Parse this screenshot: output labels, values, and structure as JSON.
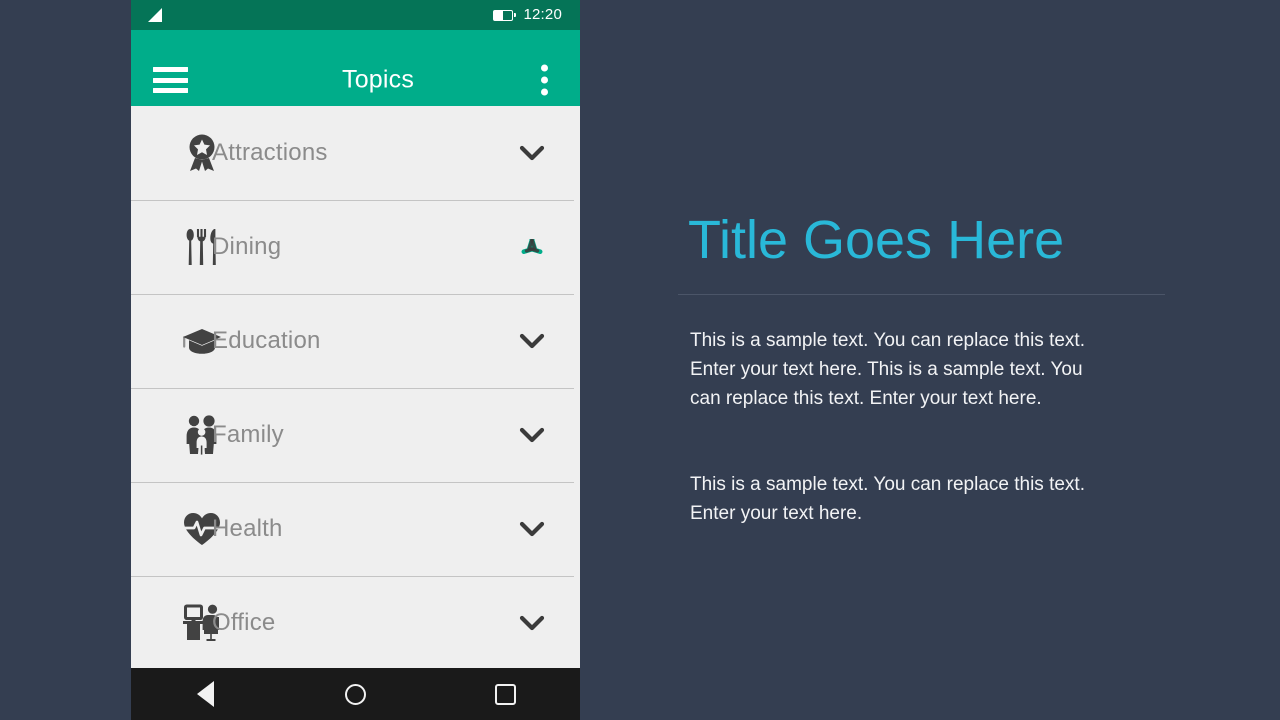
{
  "status_bar": {
    "signal_icon": "signal-bars-icon",
    "battery_icon": "battery-icon",
    "time": "12:20"
  },
  "app_bar": {
    "menu_icon": "hamburger-menu-icon",
    "title": "Topics",
    "overflow_icon": "overflow-menu-icon"
  },
  "topics": [
    {
      "label": "Attractions",
      "icon": "award-ribbon-icon",
      "expanded": false,
      "chevron_icon": "chevron-down-icon"
    },
    {
      "label": "Dining",
      "icon": "cutlery-icon",
      "expanded": true,
      "chevron_icon": "chevron-collapse-icon"
    },
    {
      "label": "Education",
      "icon": "graduation-cap-icon",
      "expanded": false,
      "chevron_icon": "chevron-down-icon"
    },
    {
      "label": "Family",
      "icon": "family-people-icon",
      "expanded": false,
      "chevron_icon": "chevron-down-icon"
    },
    {
      "label": "Health",
      "icon": "heartbeat-icon",
      "expanded": false,
      "chevron_icon": "chevron-down-icon"
    },
    {
      "label": "Office",
      "icon": "office-desk-icon",
      "expanded": false,
      "chevron_icon": "chevron-down-icon"
    }
  ],
  "nav_bar": {
    "back_icon": "triangle-back-icon",
    "home_icon": "circle-home-icon",
    "recents_icon": "square-recents-icon"
  },
  "content": {
    "title": "Title Goes Here",
    "paragraphs": [
      "This is a sample text. You can replace this text. Enter your text here. This is a sample text. You can replace this text. Enter your text here.",
      "This is a sample text. You can replace this text. Enter your text here."
    ]
  },
  "colors": {
    "status_bar": "#057457",
    "app_bar": "#00ad8a",
    "accent_teal": "#00ad8a",
    "title_cyan": "#29b8d8",
    "content_background": "#343e51",
    "list_background": "#efefef",
    "list_label": "#8b8b8b",
    "icon_dark": "#424242",
    "nav_bar": "#1a1a1a"
  }
}
